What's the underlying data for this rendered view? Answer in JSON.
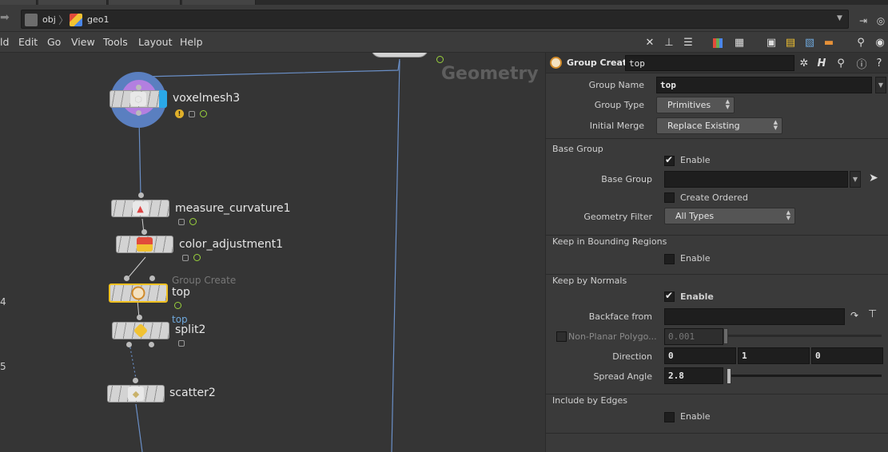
{
  "path": {
    "crumbs": [
      "obj",
      "geo1"
    ]
  },
  "menus": [
    "ld",
    "Edit",
    "Go",
    "View",
    "Tools",
    "Layout",
    "Help"
  ],
  "network": {
    "context_label": "Geometry",
    "row_numbers": [
      "4",
      "5"
    ],
    "nodes": {
      "voxelmesh": "voxelmesh3",
      "measure": "measure_curvature1",
      "color_adjust": "color_adjustment1",
      "group_create_type": "Group Create",
      "group_create_name": "top",
      "split_group": "top",
      "split": "split2",
      "scatter": "scatter2"
    }
  },
  "params": {
    "node_type": "Group Create",
    "node_name": "top",
    "group_name_label": "Group Name",
    "group_name_value": "top",
    "group_type_label": "Group Type",
    "group_type_value": "Primitives",
    "initial_merge_label": "Initial Merge",
    "initial_merge_value": "Replace Existing",
    "base_group_section": "Base Group",
    "enable": "Enable",
    "base_group_label": "Base Group",
    "base_group_value": "",
    "create_ordered": "Create Ordered",
    "geometry_filter_label": "Geometry Filter",
    "geometry_filter_value": "All Types",
    "keep_bounding_section": "Keep in Bounding Regions",
    "keep_normals_section": "Keep by Normals",
    "backface_label": "Backface from",
    "nonplanar_label": "Non-Planar Polygo...",
    "nonplanar_value": "0.001",
    "direction_label": "Direction",
    "direction": [
      "0",
      "1",
      "0"
    ],
    "spread_angle_label": "Spread Angle",
    "spread_angle_value": "2.8",
    "include_edges_section": "Include by Edges"
  },
  "colors": {
    "accent_yellow": "#f0c020",
    "wire_blue": "#6a8fc7",
    "flag_green": "#9bd33c"
  }
}
